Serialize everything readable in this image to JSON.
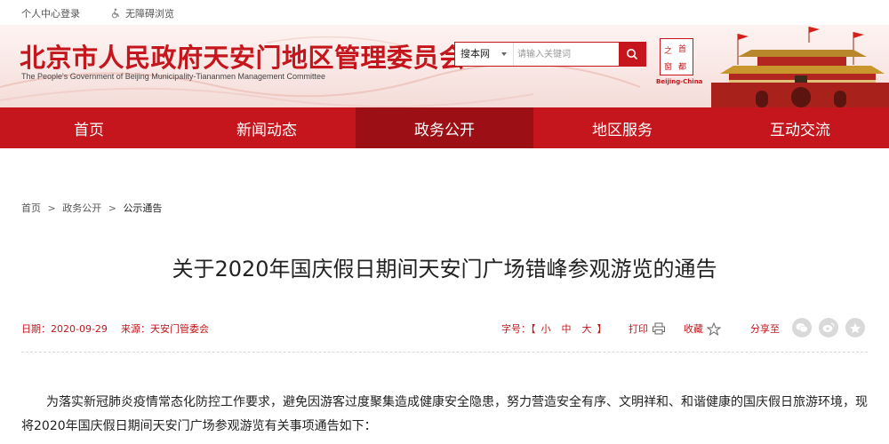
{
  "topbar": {
    "login": "个人中心登录",
    "accessibility": "无障碍浏览"
  },
  "header": {
    "title": "北京市人民政府天安门地区管理委员会",
    "subtitle": "The People's Government of Beijing Municipality-Tiananmen Management Committee",
    "search": {
      "engine": "搜本网",
      "placeholder": "请输入关键词"
    },
    "seal": {
      "chars": [
        "之",
        "首",
        "窗",
        "都"
      ],
      "caption": "Beijing-China"
    }
  },
  "nav": {
    "items": [
      {
        "label": "首页"
      },
      {
        "label": "新闻动态"
      },
      {
        "label": "政务公开"
      },
      {
        "label": "地区服务"
      },
      {
        "label": "互动交流"
      }
    ]
  },
  "breadcrumb": {
    "home": "首页",
    "section": "政务公开",
    "current": "公示通告",
    "separator": ">"
  },
  "article": {
    "title": "关于2020年国庆假日期间天安门广场错峰参观游览的通告",
    "date": "日期：2020-09-29",
    "source": "来源：天安门管委会",
    "fontsize": {
      "label": "字号：【",
      "small": "小",
      "medium": "中",
      "large": "大",
      "close": "】"
    },
    "print": "打印",
    "favorite": "收藏",
    "share": "分享至",
    "body": "为落实新冠肺炎疫情常态化防控工作要求，避免因游客过度聚集造成健康安全隐患，努力营造安全有序、文明祥和、和谐健康的国庆假日旅游环境，现将2020年国庆假日期间天安门广场参观游览有关事项通告如下："
  },
  "colors": {
    "brand_red": "#c4161c",
    "nav_active": "#9c0f14"
  },
  "icons": {
    "login": "person-icon",
    "accessibility": "wheelchair-icon",
    "search": "search-icon",
    "print": "printer-icon",
    "favorite": "star-icon",
    "share": [
      "wechat-icon",
      "weibo-icon",
      "qzone-icon"
    ]
  }
}
